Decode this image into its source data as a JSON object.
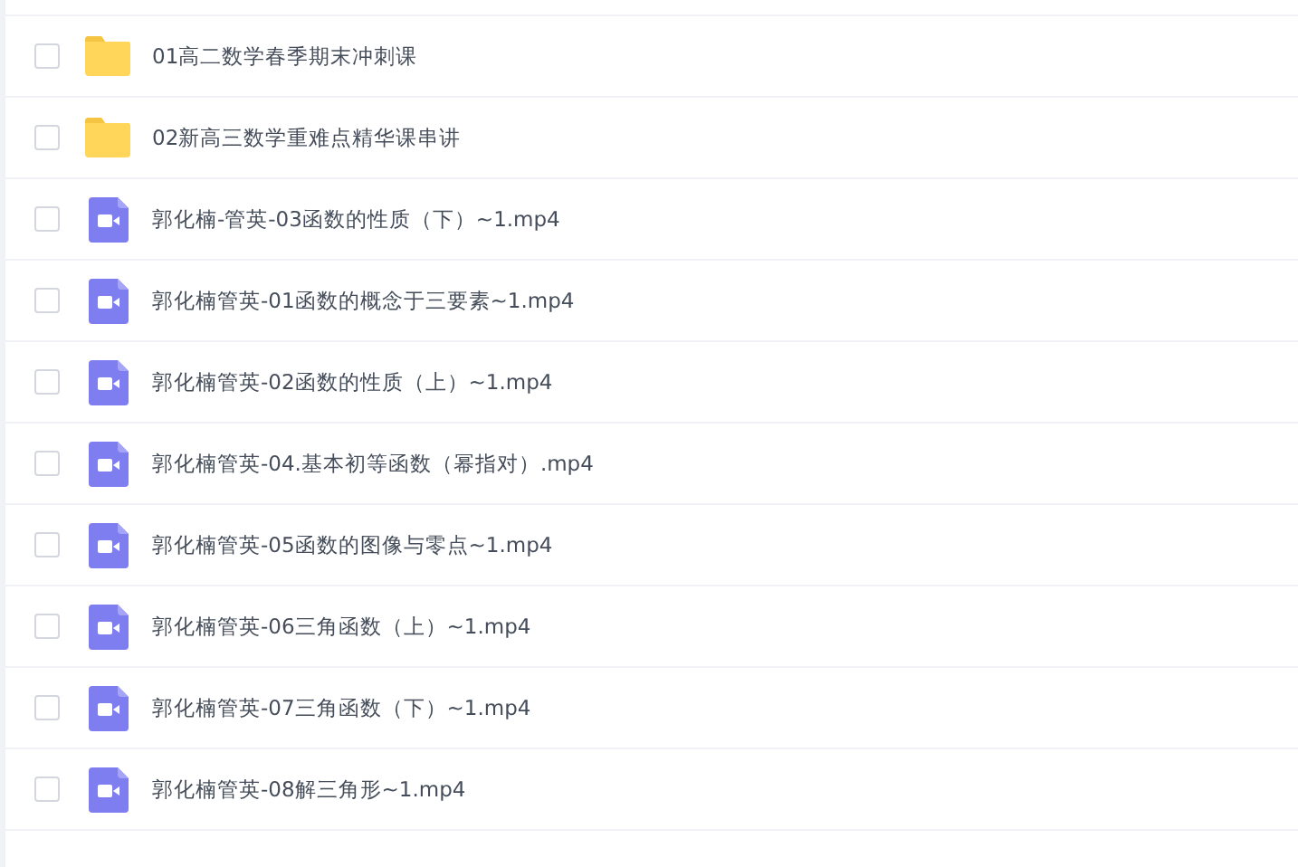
{
  "files": [
    {
      "kind": "folder",
      "name": "01高二数学春季期末冲刺课",
      "checked": false
    },
    {
      "kind": "folder",
      "name": "02新高三数学重难点精华课串讲",
      "checked": false
    },
    {
      "kind": "video",
      "name": "郭化楠-管英-03函数的性质（下）~1.mp4",
      "checked": false
    },
    {
      "kind": "video",
      "name": "郭化楠管英-01函数的概念于三要素~1.mp4",
      "checked": false
    },
    {
      "kind": "video",
      "name": "郭化楠管英-02函数的性质（上）~1.mp4",
      "checked": false
    },
    {
      "kind": "video",
      "name": "郭化楠管英-04.基本初等函数（幂指对）.mp4",
      "checked": false
    },
    {
      "kind": "video",
      "name": "郭化楠管英-05函数的图像与零点~1.mp4",
      "checked": false
    },
    {
      "kind": "video",
      "name": "郭化楠管英-06三角函数（上）~1.mp4",
      "checked": false
    },
    {
      "kind": "video",
      "name": "郭化楠管英-07三角函数（下）~1.mp4",
      "checked": false
    },
    {
      "kind": "video",
      "name": "郭化楠管英-08解三角形~1.mp4",
      "checked": false
    }
  ]
}
